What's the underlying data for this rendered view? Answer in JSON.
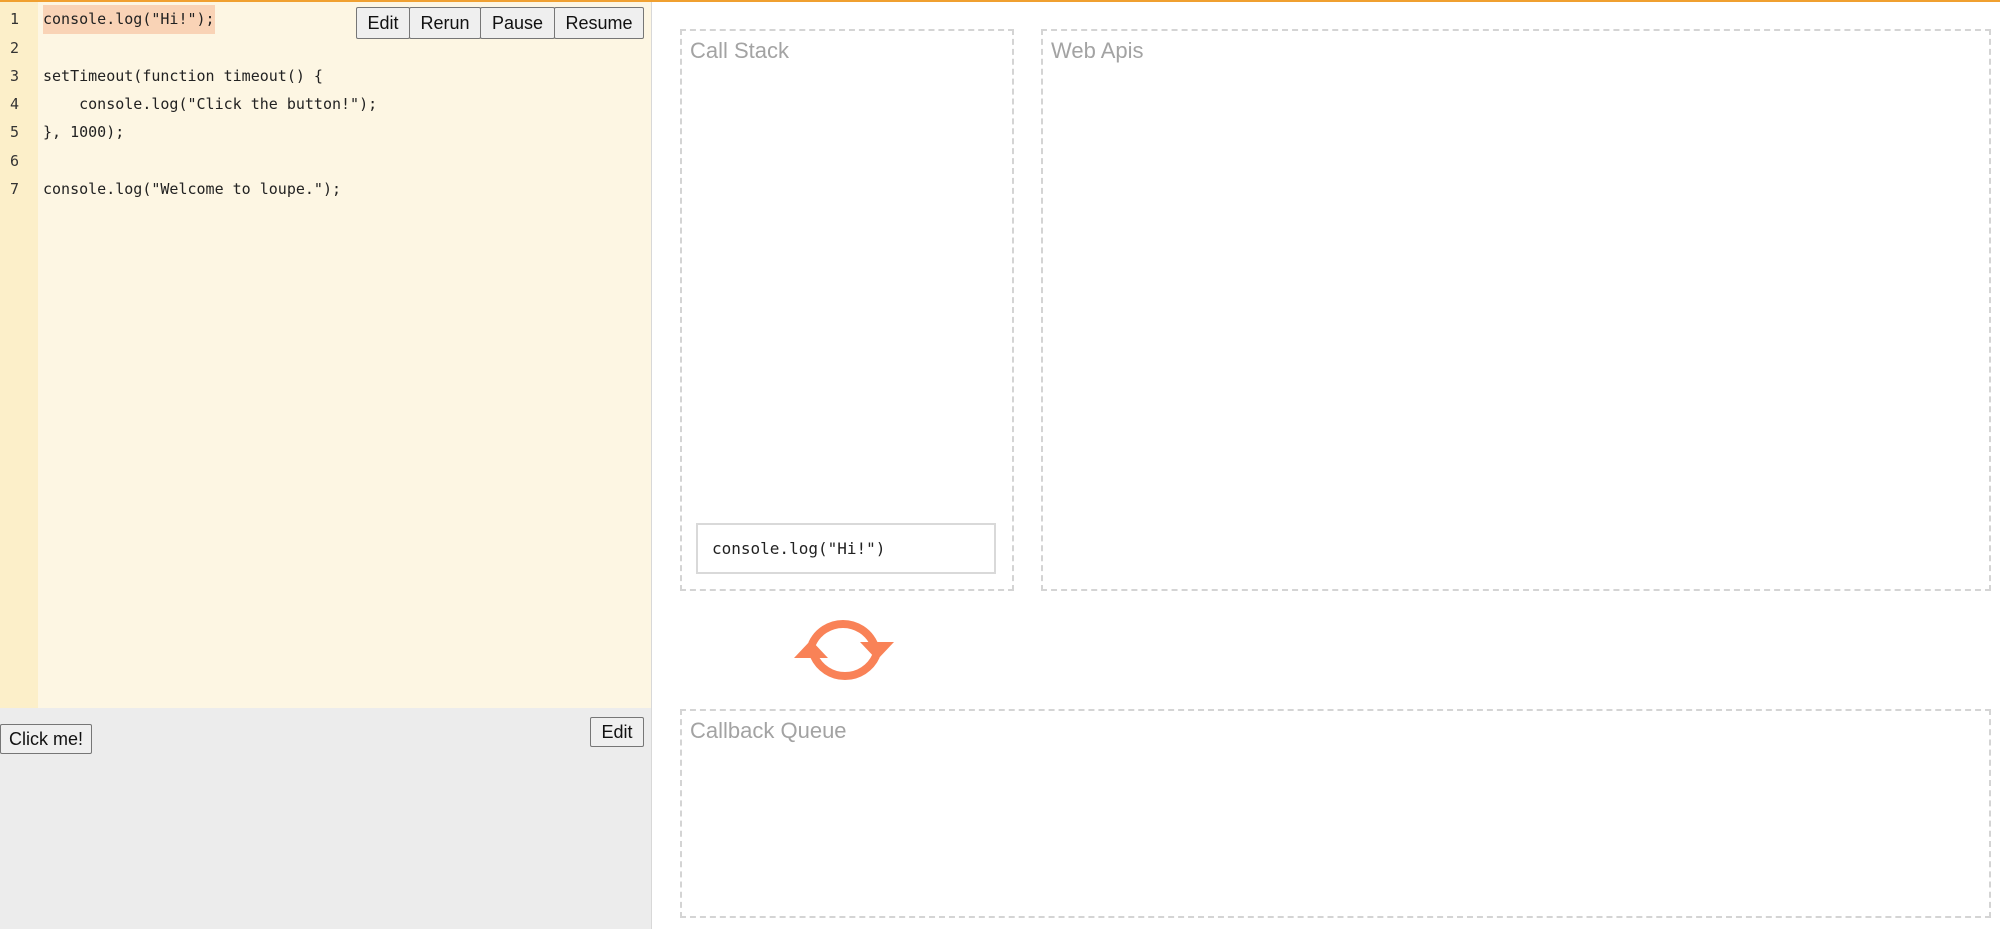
{
  "editor": {
    "lines": [
      {
        "no": "1",
        "code": "console.log(\"Hi!\");",
        "highlighted": true
      },
      {
        "no": "2",
        "code": ""
      },
      {
        "no": "3",
        "code": "setTimeout(function timeout() {"
      },
      {
        "no": "4",
        "code": "    console.log(\"Click the button!\");"
      },
      {
        "no": "5",
        "code": "}, 1000);"
      },
      {
        "no": "6",
        "code": ""
      },
      {
        "no": "7",
        "code": "console.log(\"Welcome to loupe.\");"
      }
    ],
    "toolbar": {
      "edit_label": "Edit",
      "rerun_label": "Rerun",
      "pause_label": "Pause",
      "resume_label": "Resume"
    }
  },
  "output": {
    "click_button_label": "Click me!",
    "edit_label": "Edit"
  },
  "call_stack": {
    "title": "Call Stack",
    "frames": [
      "console.log(\"Hi!\")"
    ]
  },
  "web_apis": {
    "title": "Web Apis"
  },
  "event_loop": {
    "icon": "refresh-icon",
    "color": "#f98257"
  },
  "callback_queue": {
    "title": "Callback Queue"
  },
  "colors": {
    "accent_top_bar": "#f0a030",
    "editor_bg": "#fdf6e3",
    "gutter_bg": "#fcefc9",
    "highlight": "#f9d3b6",
    "panel_border": "#d4d4d4",
    "panel_title": "#a3a3a3"
  }
}
